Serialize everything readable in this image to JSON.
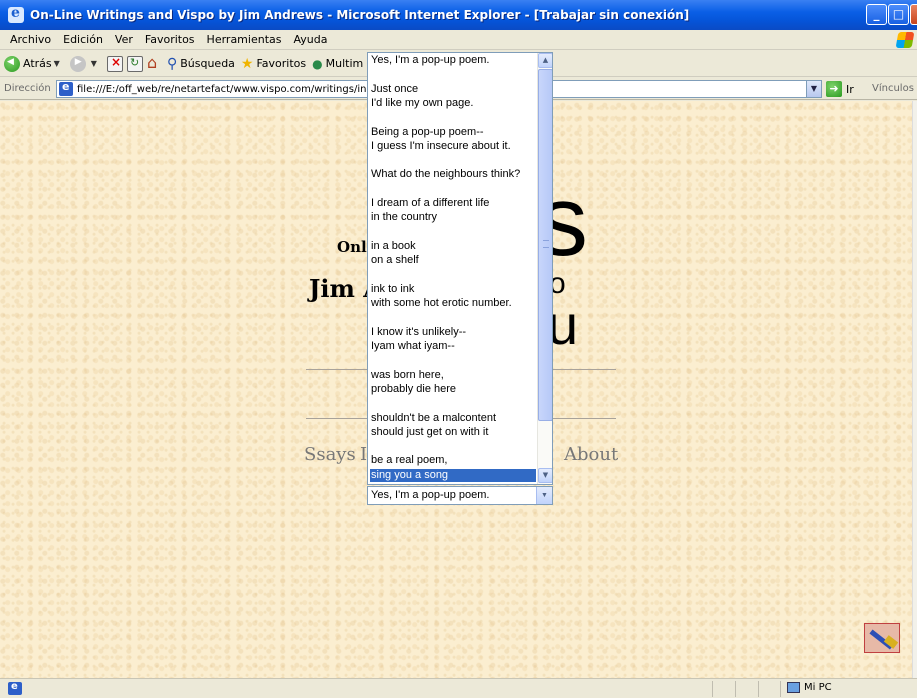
{
  "window": {
    "title": "On-Line Writings and Vispo by Jim Andrews - Microsoft Internet Explorer - [Trabajar sin conexión]",
    "buttons": [
      "_",
      "□",
      "x"
    ]
  },
  "menu": [
    "Archivo",
    "Edición",
    "Ver",
    "Favoritos",
    "Herramientas",
    "Ayuda"
  ],
  "toolbar": {
    "back_label": "Atrás",
    "search_label": "Búsqueda",
    "favorites_label": "Favoritos",
    "media_label": "Multim"
  },
  "address": {
    "label": "Dirección",
    "url": "file:///E:/off_web/re/netartefact/www.vispo.com/writings/index.htm",
    "go_label": "Ir",
    "links_label": "Vínculos"
  },
  "page": {
    "online_label": "Onli",
    "author_name": "Jim A",
    "big_letters": {
      "s": "s",
      "o": "o",
      "u": "u"
    },
    "nav": {
      "ssays": "Ssays",
      "ssays_extra": "I",
      "about": "About"
    }
  },
  "popup_list": {
    "lines": [
      "Yes, I'm a pop-up poem.",
      "",
      "Just once",
      "I'd like my own page.",
      "",
      "Being a pop-up poem--",
      "I guess I'm insecure about it.",
      "",
      "What do the neighbours think?",
      "",
      "I dream of a different life",
      "in the country",
      "",
      "in a book",
      "on a shelf",
      "",
      "ink to ink",
      "with some hot erotic number.",
      "",
      "I know it's unlikely--",
      "Iyam what iyam--",
      "",
      "was born here,",
      "probably die here",
      "",
      "shouldn't be a malcontent",
      "should just get on with it",
      "",
      "be a real poem,",
      "sing you a song"
    ],
    "selected_index": 29,
    "select_value": "Yes, I'm a pop-up poem."
  },
  "statusbar": {
    "zone": "Mi PC"
  },
  "colors": {
    "titlebar": "#0554d8",
    "selection": "#316ac5",
    "page_bg": "#fbeed0"
  }
}
